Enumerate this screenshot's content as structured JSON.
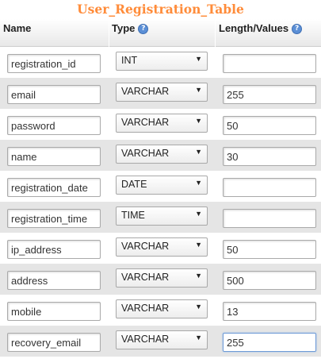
{
  "table_title": "User_Registration_Table",
  "columns": {
    "name": "Name",
    "type": "Type",
    "length": "Length/Values",
    "help_icon": "question-circle-icon"
  },
  "rows": [
    {
      "name": "registration_id",
      "type": "INT",
      "length": ""
    },
    {
      "name": "email",
      "type": "VARCHAR",
      "length": "255"
    },
    {
      "name": "password",
      "type": "VARCHAR",
      "length": "50"
    },
    {
      "name": "name",
      "type": "VARCHAR",
      "length": "30"
    },
    {
      "name": "registration_date",
      "type": "DATE",
      "length": ""
    },
    {
      "name": "registration_time",
      "type": "TIME",
      "length": ""
    },
    {
      "name": "ip_address",
      "type": "VARCHAR",
      "length": "50"
    },
    {
      "name": "address",
      "type": "VARCHAR",
      "length": "500"
    },
    {
      "name": "mobile",
      "type": "VARCHAR",
      "length": "13"
    },
    {
      "name": "recovery_email",
      "type": "VARCHAR",
      "length": "255"
    }
  ],
  "colors": {
    "title": "#ff8c3a",
    "row_alt": "#e5e5e5",
    "focus_border": "#6d9ad6"
  }
}
